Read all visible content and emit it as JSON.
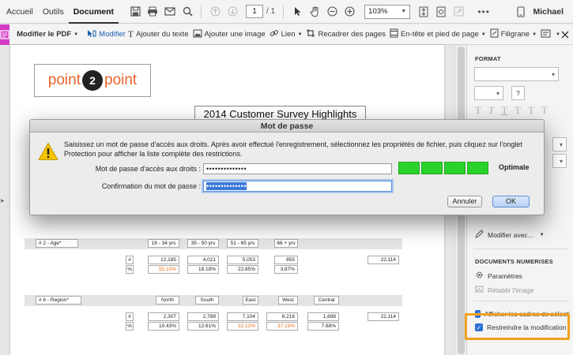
{
  "nav": {
    "tabs": [
      "Accueil",
      "Outils",
      "Document"
    ],
    "active_tab": "Document",
    "page_current": "1",
    "page_total": "/ 1",
    "zoom": "103%",
    "user": "Michael"
  },
  "edit_toolbar": {
    "modify_pdf": "Modifier le PDF",
    "items": [
      {
        "label": "Modifier",
        "icon": "edit-cursor-icon"
      },
      {
        "label": "Ajouter du texte",
        "icon": "text-icon"
      },
      {
        "label": "Ajouter une image",
        "icon": "image-icon"
      },
      {
        "label": "Lien",
        "icon": "link-icon"
      },
      {
        "label": "Recadrer des pages",
        "icon": "crop-icon"
      },
      {
        "label": "En-tête et pied de page",
        "icon": "header-footer-icon"
      },
      {
        "label": "Filigrane",
        "icon": "watermark-icon"
      }
    ]
  },
  "document": {
    "logo_left": "point",
    "logo_mid": "2",
    "logo_right": "point",
    "title": "2014 Customer Survey Highlights",
    "age_table": {
      "label": "# 2 - Age*",
      "headers": [
        "18 - 34 yrs",
        "35 - 50 yrs",
        "51 - 65 yrs",
        "66 + yrs"
      ],
      "count_symbol": "#",
      "pct_symbol": "%",
      "counts": [
        "12,185",
        "4,021",
        "5,053",
        "855"
      ],
      "percents": [
        "55.10%",
        "18.18%",
        "22.85%",
        "3.87%"
      ],
      "total": "22,114"
    },
    "region_table": {
      "label": "# 6 - Region*",
      "headers": [
        "North",
        "South",
        "East",
        "West",
        "Central"
      ],
      "count_symbol": "#",
      "pct_symbol": "%",
      "counts": [
        "2,307",
        "2,789",
        "7,104",
        "8,216",
        "1,698"
      ],
      "percents": [
        "10.43%",
        "12.61%",
        "32.12%",
        "37.15%",
        "7.68%"
      ],
      "total": "22,114"
    }
  },
  "panel": {
    "format_heading": "FORMAT",
    "help_button": "?",
    "text_format_glyphs": [
      "T",
      "T",
      "T",
      "T",
      "T",
      "T"
    ],
    "modify_with": "Modifier avec...",
    "docs_heading": "DOCUMENTS NUMERISES",
    "settings": "Paramètres",
    "restore_image": "Rétablir l'image",
    "show_boxes": "Afficher les cadres de sélection",
    "restrict_editing": "Restreindre la modification"
  },
  "dialog": {
    "title": "Mot de passe",
    "message": "Saisissez un mot de passe d'accès aux droits. Après avoir effectué l'enregistrement, sélectionnez les propriétés de fichier, puis cliquez sur l'onglet Protection pour afficher la liste complète des restrictions.",
    "password_label": "Mot de passe d'accès aux droits :",
    "password_value": "••••••••••••••",
    "confirm_label": "Confirmation du mot de passe :",
    "confirm_value": "••••••••••••••",
    "strength": "Optimale",
    "strength_level": 1.0,
    "cancel": "Annuler",
    "ok": "OK"
  },
  "colors": {
    "accent_magenta": "#d43bc5",
    "strength_green": "#2bd22b",
    "highlight_orange": "#f0a020",
    "link_blue": "#1a5fb4"
  }
}
